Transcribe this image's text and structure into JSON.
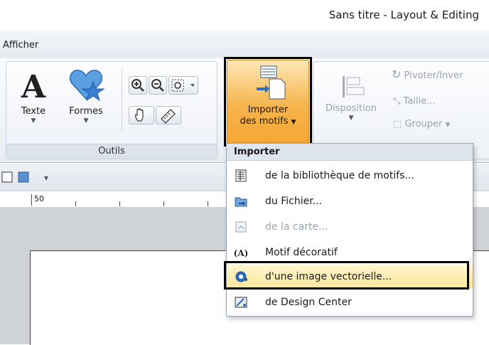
{
  "window": {
    "title": "Sans titre - Layout & Editing"
  },
  "menubar": {
    "menu_label": "Afficher"
  },
  "ribbon": {
    "outils": {
      "label": "Outils",
      "texte": "Texte",
      "formes": "Formes"
    },
    "importer_button": {
      "line1": "Importer",
      "line2": "des motifs"
    },
    "disposition": "Disposition",
    "pivoter": "Pivoter/Inver",
    "taille": "Taille...",
    "grouper": "Grouper"
  },
  "ruler": {
    "mark": "50"
  },
  "dropdown": {
    "header": "Importer",
    "items": [
      {
        "label": "de la bibliothèque de motifs...",
        "icon": "library-icon",
        "enabled": true
      },
      {
        "label": "du Fichier...",
        "icon": "folder-icon",
        "enabled": true
      },
      {
        "label": "de la carte...",
        "icon": "card-icon",
        "enabled": false
      },
      {
        "label": "Motif décoratif",
        "icon": "decorative-motif-icon",
        "enabled": true
      },
      {
        "label": "d'une image vectorielle...",
        "icon": "vector-image-icon",
        "enabled": true,
        "highlighted": true
      },
      {
        "label": "de Design Center",
        "icon": "design-center-icon",
        "enabled": true
      }
    ]
  },
  "colors": {
    "accent": "#f6b34a",
    "highlight": "#fde79a"
  }
}
